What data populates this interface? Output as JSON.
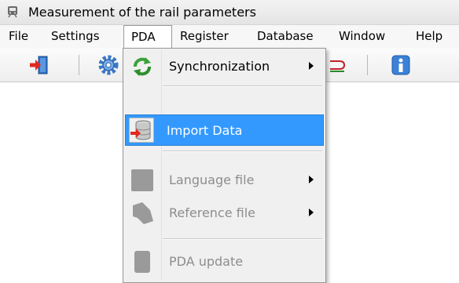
{
  "window": {
    "title": "Measurement of the rail parameters"
  },
  "menubar": {
    "items": [
      "File",
      "Settings",
      "PDA",
      "Register",
      "Database",
      "Window",
      "Help"
    ],
    "open_item": "PDA"
  },
  "toolbar": {
    "buttons": [
      "exit-door-icon",
      "settings-gear-icon",
      "rail-icon",
      "info-icon"
    ]
  },
  "pda_menu": {
    "items": [
      {
        "label": "Synchronization",
        "icon": "sync-arrows-icon",
        "enabled": true,
        "submenu": true
      },
      {
        "label": "Import Data",
        "icon": "import-database-icon",
        "enabled": true,
        "submenu": false,
        "highlighted": true
      },
      {
        "label": "Language file",
        "icon": "language-file-icon",
        "enabled": false,
        "submenu": true
      },
      {
        "label": "Reference file",
        "icon": "reference-file-icon",
        "enabled": false,
        "submenu": true
      },
      {
        "label": "PDA update",
        "icon": "pda-update-icon",
        "enabled": false,
        "submenu": false
      }
    ]
  },
  "colors": {
    "highlight": "#3399ff",
    "disabled_text": "#8d8d8d"
  }
}
